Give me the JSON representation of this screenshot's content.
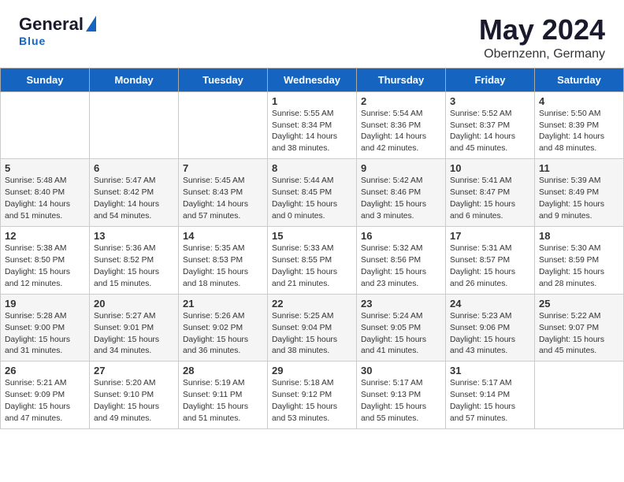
{
  "header": {
    "logo_general": "General",
    "logo_blue": "Blue",
    "month_title": "May 2024",
    "location": "Obernzenn, Germany"
  },
  "days_of_week": [
    "Sunday",
    "Monday",
    "Tuesday",
    "Wednesday",
    "Thursday",
    "Friday",
    "Saturday"
  ],
  "weeks": [
    [
      {
        "day": "",
        "sunrise": "",
        "sunset": "",
        "daylight": ""
      },
      {
        "day": "",
        "sunrise": "",
        "sunset": "",
        "daylight": ""
      },
      {
        "day": "",
        "sunrise": "",
        "sunset": "",
        "daylight": ""
      },
      {
        "day": "1",
        "sunrise": "Sunrise: 5:55 AM",
        "sunset": "Sunset: 8:34 PM",
        "daylight": "Daylight: 14 hours and 38 minutes."
      },
      {
        "day": "2",
        "sunrise": "Sunrise: 5:54 AM",
        "sunset": "Sunset: 8:36 PM",
        "daylight": "Daylight: 14 hours and 42 minutes."
      },
      {
        "day": "3",
        "sunrise": "Sunrise: 5:52 AM",
        "sunset": "Sunset: 8:37 PM",
        "daylight": "Daylight: 14 hours and 45 minutes."
      },
      {
        "day": "4",
        "sunrise": "Sunrise: 5:50 AM",
        "sunset": "Sunset: 8:39 PM",
        "daylight": "Daylight: 14 hours and 48 minutes."
      }
    ],
    [
      {
        "day": "5",
        "sunrise": "Sunrise: 5:48 AM",
        "sunset": "Sunset: 8:40 PM",
        "daylight": "Daylight: 14 hours and 51 minutes."
      },
      {
        "day": "6",
        "sunrise": "Sunrise: 5:47 AM",
        "sunset": "Sunset: 8:42 PM",
        "daylight": "Daylight: 14 hours and 54 minutes."
      },
      {
        "day": "7",
        "sunrise": "Sunrise: 5:45 AM",
        "sunset": "Sunset: 8:43 PM",
        "daylight": "Daylight: 14 hours and 57 minutes."
      },
      {
        "day": "8",
        "sunrise": "Sunrise: 5:44 AM",
        "sunset": "Sunset: 8:45 PM",
        "daylight": "Daylight: 15 hours and 0 minutes."
      },
      {
        "day": "9",
        "sunrise": "Sunrise: 5:42 AM",
        "sunset": "Sunset: 8:46 PM",
        "daylight": "Daylight: 15 hours and 3 minutes."
      },
      {
        "day": "10",
        "sunrise": "Sunrise: 5:41 AM",
        "sunset": "Sunset: 8:47 PM",
        "daylight": "Daylight: 15 hours and 6 minutes."
      },
      {
        "day": "11",
        "sunrise": "Sunrise: 5:39 AM",
        "sunset": "Sunset: 8:49 PM",
        "daylight": "Daylight: 15 hours and 9 minutes."
      }
    ],
    [
      {
        "day": "12",
        "sunrise": "Sunrise: 5:38 AM",
        "sunset": "Sunset: 8:50 PM",
        "daylight": "Daylight: 15 hours and 12 minutes."
      },
      {
        "day": "13",
        "sunrise": "Sunrise: 5:36 AM",
        "sunset": "Sunset: 8:52 PM",
        "daylight": "Daylight: 15 hours and 15 minutes."
      },
      {
        "day": "14",
        "sunrise": "Sunrise: 5:35 AM",
        "sunset": "Sunset: 8:53 PM",
        "daylight": "Daylight: 15 hours and 18 minutes."
      },
      {
        "day": "15",
        "sunrise": "Sunrise: 5:33 AM",
        "sunset": "Sunset: 8:55 PM",
        "daylight": "Daylight: 15 hours and 21 minutes."
      },
      {
        "day": "16",
        "sunrise": "Sunrise: 5:32 AM",
        "sunset": "Sunset: 8:56 PM",
        "daylight": "Daylight: 15 hours and 23 minutes."
      },
      {
        "day": "17",
        "sunrise": "Sunrise: 5:31 AM",
        "sunset": "Sunset: 8:57 PM",
        "daylight": "Daylight: 15 hours and 26 minutes."
      },
      {
        "day": "18",
        "sunrise": "Sunrise: 5:30 AM",
        "sunset": "Sunset: 8:59 PM",
        "daylight": "Daylight: 15 hours and 28 minutes."
      }
    ],
    [
      {
        "day": "19",
        "sunrise": "Sunrise: 5:28 AM",
        "sunset": "Sunset: 9:00 PM",
        "daylight": "Daylight: 15 hours and 31 minutes."
      },
      {
        "day": "20",
        "sunrise": "Sunrise: 5:27 AM",
        "sunset": "Sunset: 9:01 PM",
        "daylight": "Daylight: 15 hours and 34 minutes."
      },
      {
        "day": "21",
        "sunrise": "Sunrise: 5:26 AM",
        "sunset": "Sunset: 9:02 PM",
        "daylight": "Daylight: 15 hours and 36 minutes."
      },
      {
        "day": "22",
        "sunrise": "Sunrise: 5:25 AM",
        "sunset": "Sunset: 9:04 PM",
        "daylight": "Daylight: 15 hours and 38 minutes."
      },
      {
        "day": "23",
        "sunrise": "Sunrise: 5:24 AM",
        "sunset": "Sunset: 9:05 PM",
        "daylight": "Daylight: 15 hours and 41 minutes."
      },
      {
        "day": "24",
        "sunrise": "Sunrise: 5:23 AM",
        "sunset": "Sunset: 9:06 PM",
        "daylight": "Daylight: 15 hours and 43 minutes."
      },
      {
        "day": "25",
        "sunrise": "Sunrise: 5:22 AM",
        "sunset": "Sunset: 9:07 PM",
        "daylight": "Daylight: 15 hours and 45 minutes."
      }
    ],
    [
      {
        "day": "26",
        "sunrise": "Sunrise: 5:21 AM",
        "sunset": "Sunset: 9:09 PM",
        "daylight": "Daylight: 15 hours and 47 minutes."
      },
      {
        "day": "27",
        "sunrise": "Sunrise: 5:20 AM",
        "sunset": "Sunset: 9:10 PM",
        "daylight": "Daylight: 15 hours and 49 minutes."
      },
      {
        "day": "28",
        "sunrise": "Sunrise: 5:19 AM",
        "sunset": "Sunset: 9:11 PM",
        "daylight": "Daylight: 15 hours and 51 minutes."
      },
      {
        "day": "29",
        "sunrise": "Sunrise: 5:18 AM",
        "sunset": "Sunset: 9:12 PM",
        "daylight": "Daylight: 15 hours and 53 minutes."
      },
      {
        "day": "30",
        "sunrise": "Sunrise: 5:17 AM",
        "sunset": "Sunset: 9:13 PM",
        "daylight": "Daylight: 15 hours and 55 minutes."
      },
      {
        "day": "31",
        "sunrise": "Sunrise: 5:17 AM",
        "sunset": "Sunset: 9:14 PM",
        "daylight": "Daylight: 15 hours and 57 minutes."
      },
      {
        "day": "",
        "sunrise": "",
        "sunset": "",
        "daylight": ""
      }
    ]
  ]
}
